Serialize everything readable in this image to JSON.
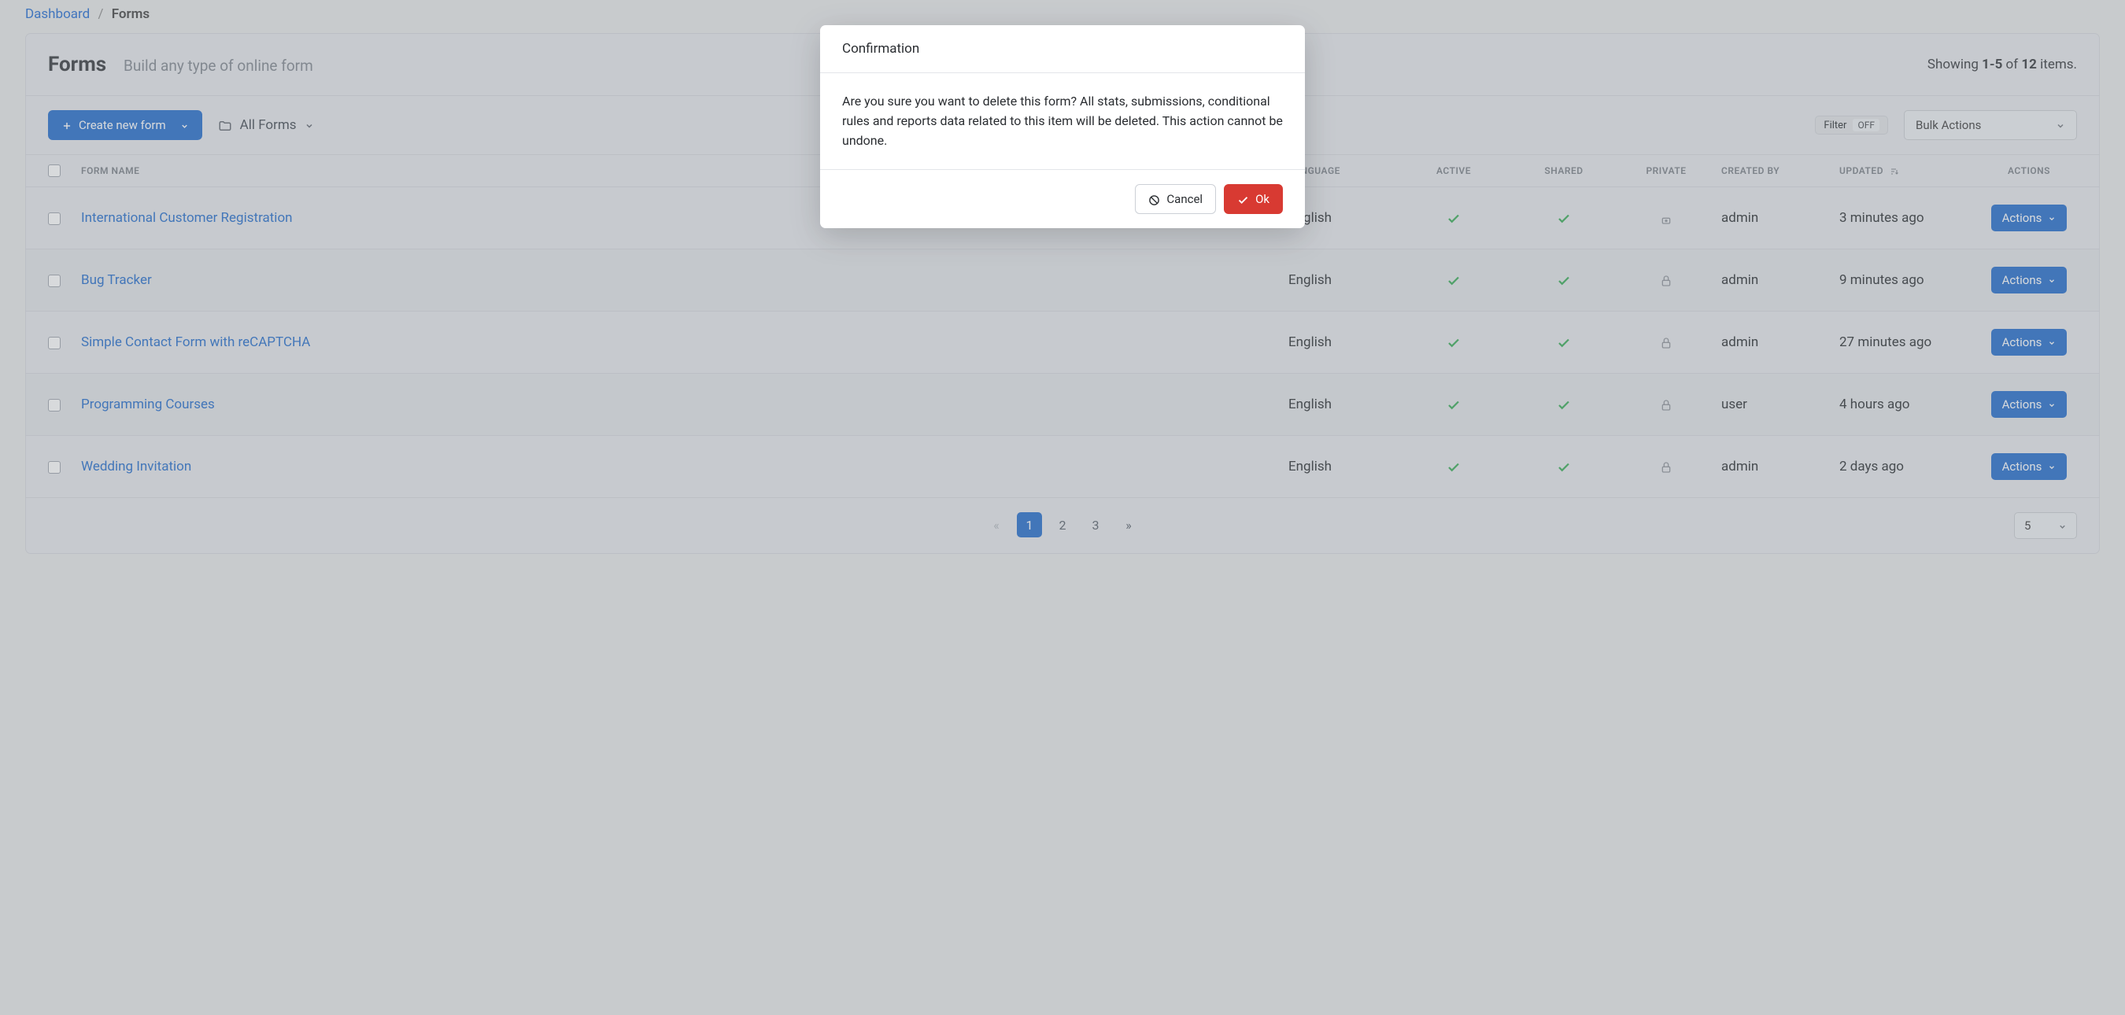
{
  "breadcrumb": {
    "root": "Dashboard",
    "current": "Forms"
  },
  "header": {
    "title": "Forms",
    "subtitle": "Build any type of online form",
    "showing_prefix": "Showing ",
    "showing_range": "1-5",
    "showing_of": " of ",
    "showing_total": "12",
    "showing_suffix": " items."
  },
  "toolbar": {
    "create_label": "Create new form",
    "folder_label": "All Forms",
    "filter_label": "Filter",
    "filter_state": "OFF",
    "bulk_label": "Bulk Actions"
  },
  "columns": {
    "name": "Form Name",
    "language": "Language",
    "active": "Active",
    "shared": "Shared",
    "private": "Private",
    "created_by": "Created By",
    "updated": "Updated",
    "actions": "Actions"
  },
  "rows": [
    {
      "name": "International Customer Registration",
      "language": "English",
      "active": true,
      "shared": true,
      "private": "locked-open",
      "created_by": "admin",
      "updated": "3 minutes ago"
    },
    {
      "name": "Bug Tracker",
      "language": "English",
      "active": true,
      "shared": true,
      "private": "locked",
      "created_by": "admin",
      "updated": "9 minutes ago"
    },
    {
      "name": "Simple Contact Form with reCAPTCHA",
      "language": "English",
      "active": true,
      "shared": true,
      "private": "locked",
      "created_by": "admin",
      "updated": "27 minutes ago"
    },
    {
      "name": "Programming Courses",
      "language": "English",
      "active": true,
      "shared": true,
      "private": "locked",
      "created_by": "user",
      "updated": "4 hours ago"
    },
    {
      "name": "Wedding Invitation",
      "language": "English",
      "active": true,
      "shared": true,
      "private": "locked",
      "created_by": "admin",
      "updated": "2 days ago"
    }
  ],
  "actions_label": "Actions",
  "pagination": {
    "pages": [
      "1",
      "2",
      "3"
    ],
    "active": "1",
    "per_page": "5"
  },
  "modal": {
    "title": "Confirmation",
    "body": "Are you sure you want to delete this form? All stats, submissions, conditional rules and reports data related to this item will be deleted. This action cannot be undone.",
    "cancel": "Cancel",
    "ok": "Ok"
  }
}
